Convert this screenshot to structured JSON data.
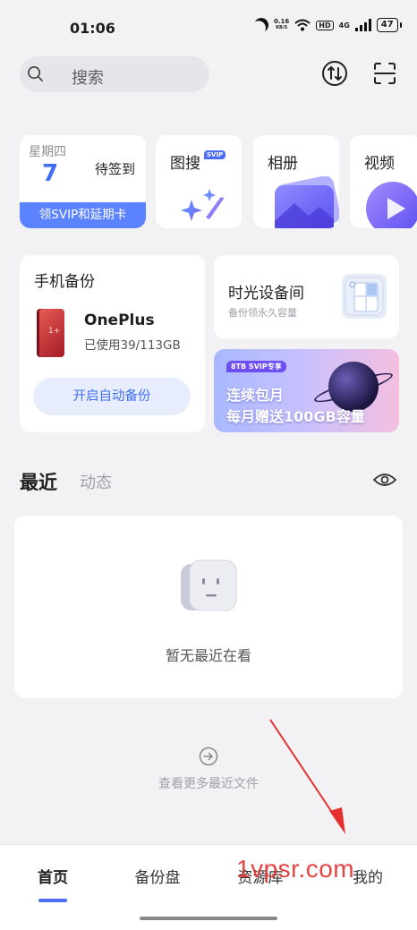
{
  "status_bar": {
    "time": "01:06",
    "net_speed_value": "0.16",
    "net_speed_unit": "KB/S",
    "hd": "HD",
    "network": "4G",
    "battery": "47"
  },
  "header": {
    "search_placeholder": "搜索",
    "icons": [
      "search-icon",
      "transfer-icon",
      "scan-icon"
    ]
  },
  "signin": {
    "weekday": "星期四",
    "day": "7",
    "label": "待签到",
    "svip_action": "领SVIP和延期卡"
  },
  "tiles": [
    {
      "label": "图搜",
      "badge": "SVIP"
    },
    {
      "label": "相册"
    },
    {
      "label": "视频"
    }
  ],
  "backup": {
    "title": "手机备份",
    "device_name": "OnePlus",
    "usage": "已使用39/113GB",
    "button": "开启自动备份",
    "phone_logo": "1+"
  },
  "time_device": {
    "title": "时光设备间",
    "subtitle": "备份领永久容量"
  },
  "promo": {
    "badge": "8TB SVIP专享",
    "line1": "连续包月",
    "line2": "每月赠送100GB容量"
  },
  "recent": {
    "tab_recent": "最近",
    "tab_activity": "动态",
    "empty_text": "暂无最近在看",
    "more_text": "查看更多最近文件"
  },
  "watermark": "1vpsr.com",
  "bottom_nav": {
    "items": [
      "首页",
      "备份盘",
      "资源库",
      "我的"
    ],
    "active": "首页"
  },
  "colors": {
    "accent": "#4c6ef5",
    "accent_light": "#e8edfd",
    "background": "#f2f2f4",
    "watermark": "#e53030"
  }
}
